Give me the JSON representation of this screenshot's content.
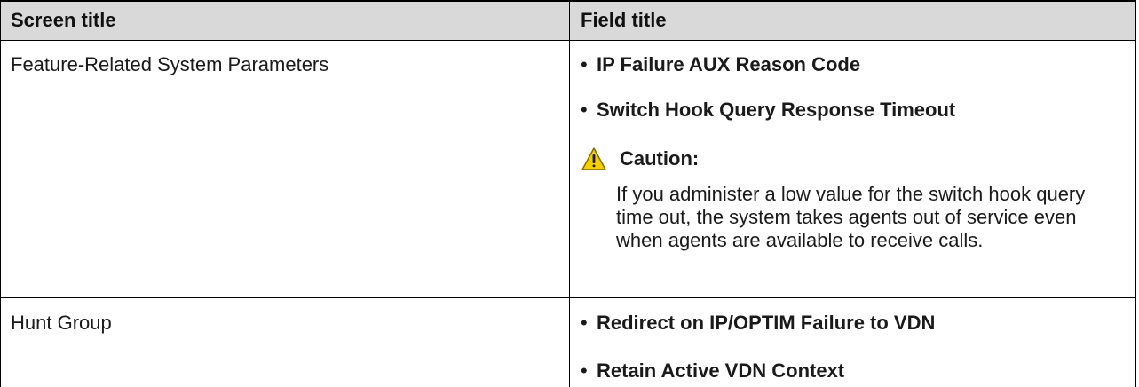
{
  "table": {
    "headers": {
      "screen_title": "Screen title",
      "field_title": "Field title"
    },
    "rows": [
      {
        "screen_title": "Feature-Related System Parameters",
        "fields": [
          "IP Failure AUX Reason Code",
          "Switch Hook Query Response Timeout"
        ],
        "caution": {
          "label": "Caution:",
          "text": "If you administer a low value for the switch hook query time out, the system takes agents out of service even when agents are available to receive calls."
        }
      },
      {
        "screen_title": "Hunt Group",
        "fields": [
          "Redirect on IP/OPTIM Failure to VDN",
          "Retain Active VDN Context"
        ]
      }
    ]
  },
  "bullet_char": "•",
  "colors": {
    "header_background": "#d9d9d9",
    "border": "#000000",
    "caution_yellow": "#f5d000"
  },
  "icons": {
    "caution": "caution-triangle-icon"
  }
}
